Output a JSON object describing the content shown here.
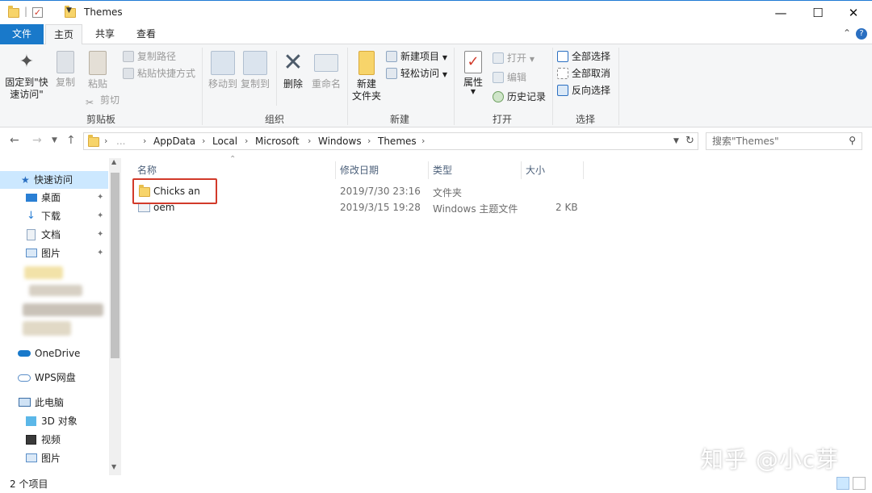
{
  "window": {
    "title": "Themes",
    "minimize": "—",
    "maximize": "☐",
    "close": "✕"
  },
  "tabs": [
    {
      "label": "文件"
    },
    {
      "label": "主页"
    },
    {
      "label": "共享"
    },
    {
      "label": "查看"
    }
  ],
  "ribbon": {
    "clipboard": {
      "group_label": "剪贴板",
      "pin_label": "固定到\"快\n速访问\"",
      "copy_label": "复制",
      "paste_label": "粘贴",
      "copy_path": "复制路径",
      "paste_shortcut": "粘贴快捷方式",
      "cut": "剪切"
    },
    "organize": {
      "group_label": "组织",
      "move_to": "移动到",
      "copy_to": "复制到",
      "delete": "删除",
      "rename": "重命名"
    },
    "new": {
      "group_label": "新建",
      "new_folder": "新建\n文件夹",
      "new_item": "新建项目",
      "easy_access": "轻松访问"
    },
    "open": {
      "group_label": "打开",
      "properties": "属性",
      "open": "打开",
      "edit": "编辑",
      "history": "历史记录"
    },
    "select": {
      "group_label": "选择",
      "select_all": "全部选择",
      "select_none": "全部取消",
      "invert": "反向选择"
    }
  },
  "address": {
    "crumbs": [
      "...",
      "AppData",
      "Local",
      "Microsoft",
      "Windows",
      "Themes"
    ],
    "search_placeholder": "搜索\"Themes\""
  },
  "navpane": {
    "quick_access": "快速访问",
    "pinned": [
      "桌面",
      "下载",
      "文档",
      "图片"
    ],
    "onedrive": "OneDrive",
    "wps": "WPS网盘",
    "this_pc": "此电脑",
    "pc_items": [
      "3D 对象",
      "视频",
      "图片"
    ]
  },
  "columns": {
    "name": "名称",
    "modified": "修改日期",
    "type": "类型",
    "size": "大小"
  },
  "files": [
    {
      "name": "Chicks an",
      "modified": "2019/7/30 23:16",
      "type": "文件夹",
      "size": ""
    },
    {
      "name": "oem",
      "modified": "2019/3/15 19:28",
      "type": "Windows 主题文件",
      "size": "2 KB"
    }
  ],
  "status": {
    "count": "2 个项目"
  },
  "watermark": "知乎 @小c芽",
  "colors": {
    "accent": "#1979ca",
    "highlight_box": "#d23a2a",
    "selection": "#cce8ff"
  }
}
